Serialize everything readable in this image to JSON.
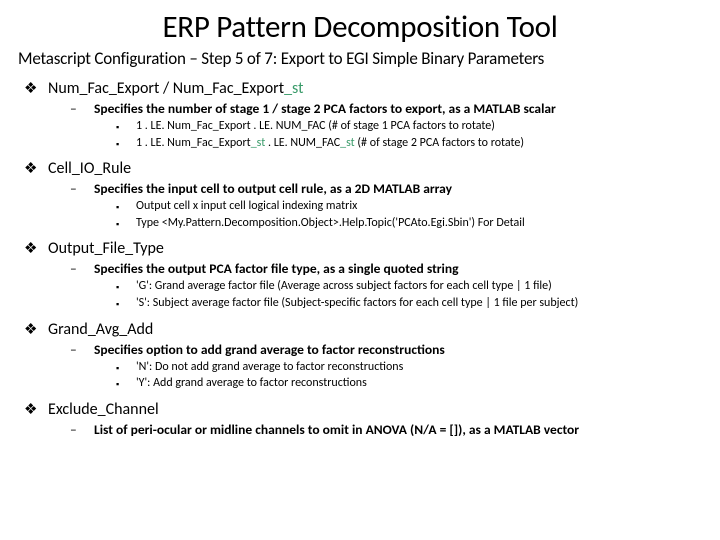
{
  "title": "ERP Pattern Decomposition Tool",
  "subtitle": "Metascript Configuration – Step 5 of 7: Export to EGI Simple Binary Parameters",
  "sections": [
    {
      "head_a": "Num_Fac_Export / Num_Fac_Export",
      "head_b": "_st",
      "desc": "Specifies the number of stage 1 / stage 2 PCA factors to export, as a MATLAB scalar",
      "items": [
        {
          "a": "1 . LE. Num_Fac_Export . LE. NUM_FAC (# of stage 1 PCA factors to rotate)",
          "b": ""
        },
        {
          "a": "1 . LE. Num_Fac_Export",
          "b": "_st",
          "c": " . LE. NUM_FAC",
          "d": "_st",
          "e": " (# of stage 2 PCA factors to rotate)"
        }
      ]
    },
    {
      "head_a": "Cell_IO_Rule",
      "desc": "Specifies the input cell to output cell rule, as a 2D MATLAB array",
      "items": [
        {
          "a": "Output cell x input cell logical indexing matrix"
        },
        {
          "a": "Type <My.Pattern.Decomposition.Object>.Help.Topic('PCAto.Egi.Sbin') For Detail"
        }
      ]
    },
    {
      "head_a": "Output_File_Type",
      "desc": "Specifies the output PCA factor file type, as a single quoted string",
      "items": [
        {
          "a": "'G': Grand average factor file (Average across subject factors for each cell type | 1 file)"
        },
        {
          "a": "'S': Subject average factor file (Subject-specific factors for each cell type | 1 file per subject)"
        }
      ]
    },
    {
      "head_a": "Grand_Avg_Add",
      "desc": "Specifies option to add grand average to factor reconstructions",
      "items": [
        {
          "a": "'N': Do not add grand average to factor reconstructions"
        },
        {
          "a": "'Y': Add grand average to factor reconstructions"
        }
      ]
    },
    {
      "head_a": "Exclude_Channel",
      "desc": "List of peri-ocular or midline channels to omit in ANOVA (N/A = []), as a MATLAB vector",
      "items": []
    }
  ]
}
